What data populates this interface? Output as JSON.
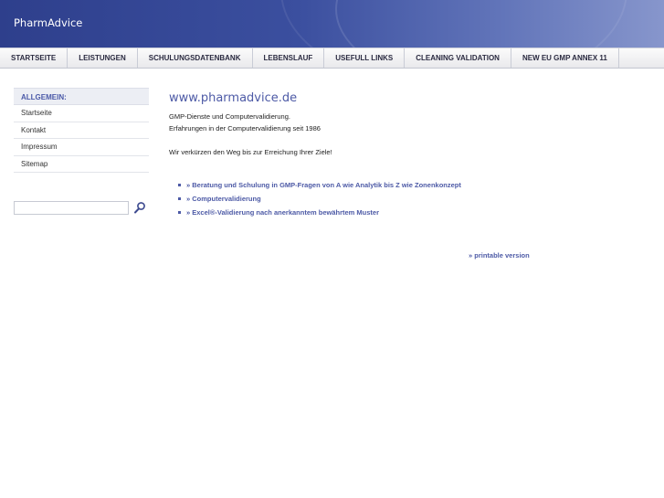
{
  "header": {
    "logo": "PharmAdvice"
  },
  "nav": {
    "items": [
      {
        "label": "STARTSEITE"
      },
      {
        "label": "LEISTUNGEN"
      },
      {
        "label": "SCHULUNGSDATENBANK"
      },
      {
        "label": "LEBENSLAUF"
      },
      {
        "label": "USEFULL LINKS"
      },
      {
        "label": "CLEANING VALIDATION"
      },
      {
        "label": "NEW EU GMP ANNEX 11"
      }
    ]
  },
  "sidebar": {
    "heading": "ALLGEMEIN:",
    "items": [
      {
        "label": "Startseite"
      },
      {
        "label": "Kontakt"
      },
      {
        "label": "Impressum"
      },
      {
        "label": "Sitemap"
      }
    ]
  },
  "search": {
    "value": "",
    "icon": "search-icon"
  },
  "content": {
    "title": "www.pharmadvice.de",
    "intro_line1": "GMP-Dienste und Computervalidierung.",
    "intro_line2": "Erfahrungen in der Computervalidierung seit 1986",
    "slogan": "Wir verkürzen den Weg bis zur Erreichung Ihrer Ziele!",
    "links": [
      {
        "label": "» Beratung und Schulung in GMP-Fragen von A wie Analytik bis Z wie Zonenkonzept"
      },
      {
        "label": "» Computervalidierung"
      },
      {
        "label": "» Excel®-Validierung nach anerkanntem bewährtem Muster"
      }
    ],
    "printable": "» printable version"
  },
  "colors": {
    "accent": "#4d5aa6",
    "header_dark": "#2e3f8c",
    "header_light": "#8796cc"
  }
}
